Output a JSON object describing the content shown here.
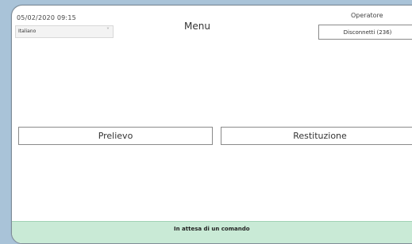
{
  "header": {
    "datetime": "05/02/2020 09:15",
    "title": "Menu",
    "operator_label": "Operatore"
  },
  "language_select": {
    "selected": "Italiano",
    "caret": "˅"
  },
  "operator": {
    "disconnect_label": "Disconnetti (236)"
  },
  "menu": {
    "prelievo_label": "Prelievo",
    "restituzione_label": "Restituzione"
  },
  "status": {
    "text": "In attesa di un comando",
    "bar_color": "#c9ead6"
  }
}
